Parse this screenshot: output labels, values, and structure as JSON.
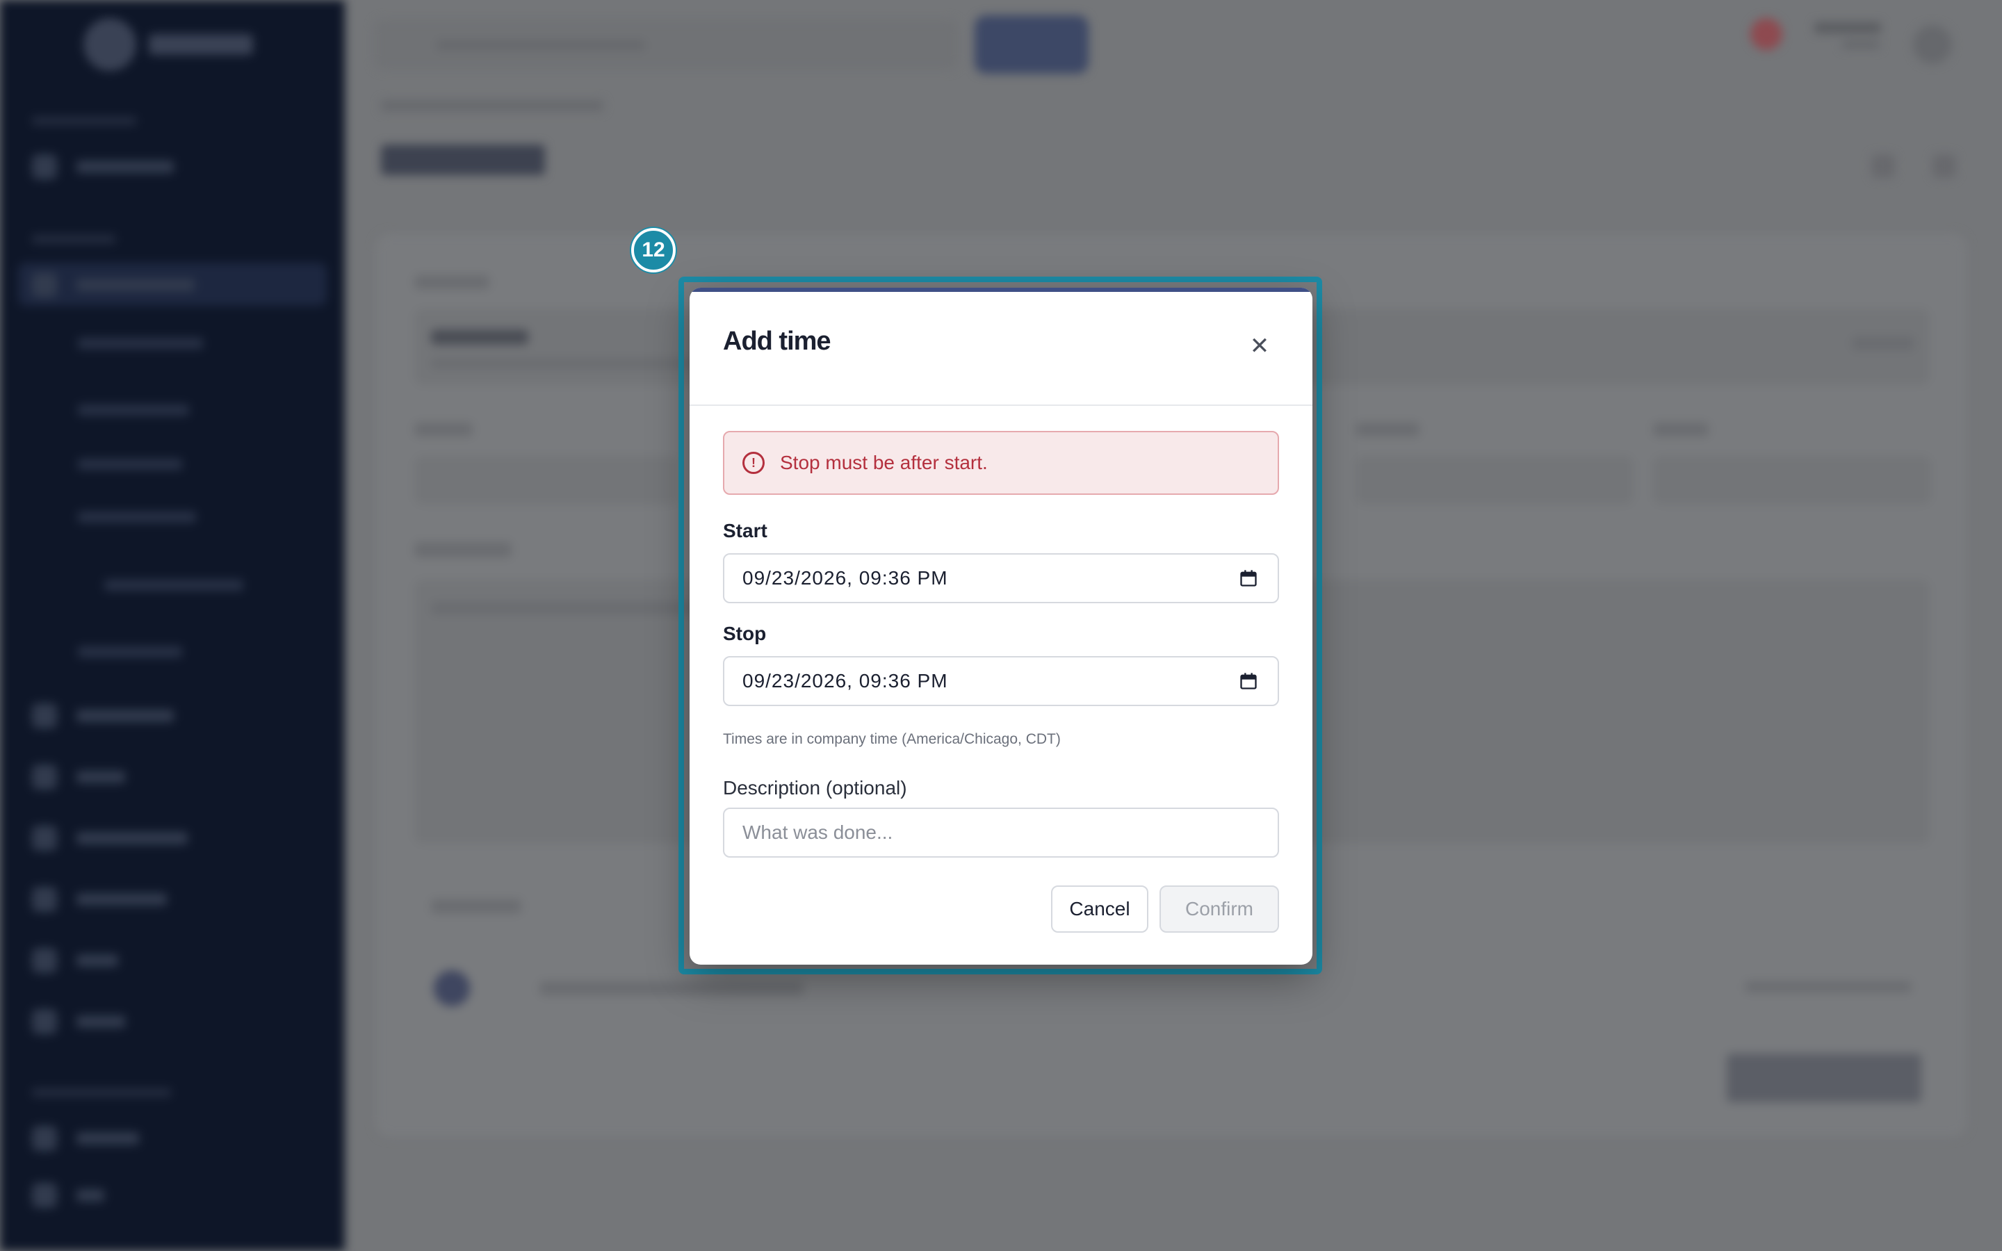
{
  "annotation": {
    "badge": "12"
  },
  "dialog": {
    "title": "Add time",
    "close_icon": "close-icon",
    "error": {
      "icon": "alert-circle-icon",
      "message": "Stop must be after start."
    },
    "start": {
      "label": "Start",
      "value": "09/23/2026, 09:36 PM",
      "icon": "calendar-icon"
    },
    "stop": {
      "label": "Stop",
      "value": "09/23/2026, 09:36 PM",
      "icon": "calendar-icon"
    },
    "timezone_hint": "Times are in company time (America/Chicago, CDT)",
    "description": {
      "label": "Description (optional)",
      "placeholder": "What was done..."
    },
    "cancel_label": "Cancel",
    "confirm_label": "Confirm"
  },
  "colors": {
    "highlight": "#1c8ba6",
    "error_text": "#b4303e",
    "error_bg": "#f8e9ea",
    "sidebar": "#0e1628",
    "accent": "#3f4f86"
  }
}
